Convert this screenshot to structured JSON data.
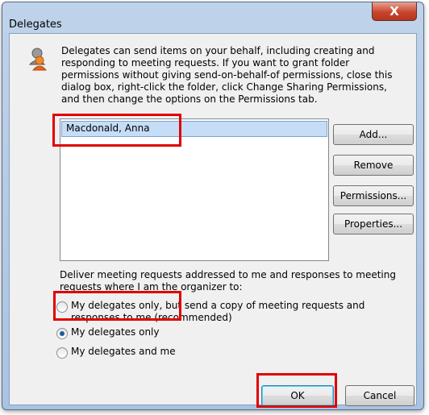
{
  "window": {
    "title": "Delegates",
    "close_glyph": "X"
  },
  "description": "Delegates can send items on your behalf, including creating and responding to meeting requests. If you want to grant folder permissions without giving send-on-behalf-of permissions, close this dialog box, right-click the folder, click Change Sharing Permissions, and then change the options on the Permissions tab.",
  "delegates_list": {
    "items": [
      "Macdonald, Anna"
    ],
    "selected": "Macdonald, Anna"
  },
  "buttons": {
    "add": "Add...",
    "remove": "Remove",
    "permissions": "Permissions...",
    "properties": "Properties...",
    "ok": "OK",
    "cancel": "Cancel"
  },
  "meeting_requests": {
    "label": "Deliver meeting requests addressed to me and responses to meeting requests where I am the organizer to:",
    "options": [
      "My delegates only, but send a copy of meeting requests and responses to me (recommended)",
      "My delegates only",
      "My delegates and me"
    ],
    "selected": "My delegates only"
  },
  "colors": {
    "highlight": "#e00000",
    "selection": "#c6ddf7",
    "titlebar": "#bfd3ea",
    "close_button": "#c8452e"
  },
  "icons": {
    "dialog_icon": "delegates-people-icon"
  }
}
